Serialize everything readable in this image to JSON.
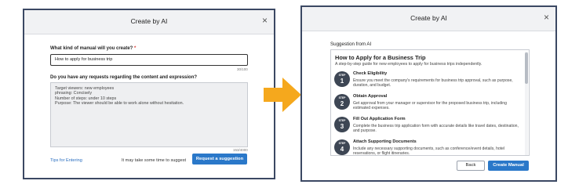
{
  "left_dialog": {
    "title": "Create by AI",
    "close_symbol": "×",
    "manual_label": "What kind of manual will you create?",
    "required_mark": "*",
    "manual_value": "How to apply for business trip",
    "manual_counter": "30/100",
    "requests_label": "Do you have any requests regarding the content and expression?",
    "requests_lines": [
      "Target viewers: new employees",
      "phrasing: Concisely",
      "Number of steps: under 10 steps",
      "Purpose: The viewer should be able to work alone without hesitation."
    ],
    "requests_counter": "153/4000",
    "tips_link": "Tips for Entering",
    "hint_text": "It may take some time to suggest",
    "request_button": "Request a suggestion"
  },
  "right_dialog": {
    "title": "Create by AI",
    "close_symbol": "×",
    "suggestion_label": "Suggestion from AI",
    "manual_title": "How to Apply for a Business Trip",
    "manual_subtitle": "A step-by-step guide for new employees to apply for business trips independently.",
    "step_word": "STEP",
    "steps": [
      {
        "num": "1",
        "title": "Check Eligibility",
        "desc": "Ensure you meet the company's requirements for business trip approval, such as purpose, duration, and budget."
      },
      {
        "num": "2",
        "title": "Obtain Approval",
        "desc": "Get approval from your manager or supervisor for the proposed business trip, including estimated expenses."
      },
      {
        "num": "3",
        "title": "Fill Out Application Form",
        "desc": "Complete the business trip application form with accurate details like travel dates, destination, and purpose."
      },
      {
        "num": "4",
        "title": "Attach Supporting Documents",
        "desc": "Include any necessary supporting documents, such as conference/event details, hotel reservations, or flight itineraries."
      }
    ],
    "back_button": "Back",
    "create_button": "Create Manual"
  },
  "colors": {
    "frame": "#3b4863",
    "primary": "#2a78c9",
    "arrow": "#f5a81d",
    "step_circle": "#3d4654"
  }
}
